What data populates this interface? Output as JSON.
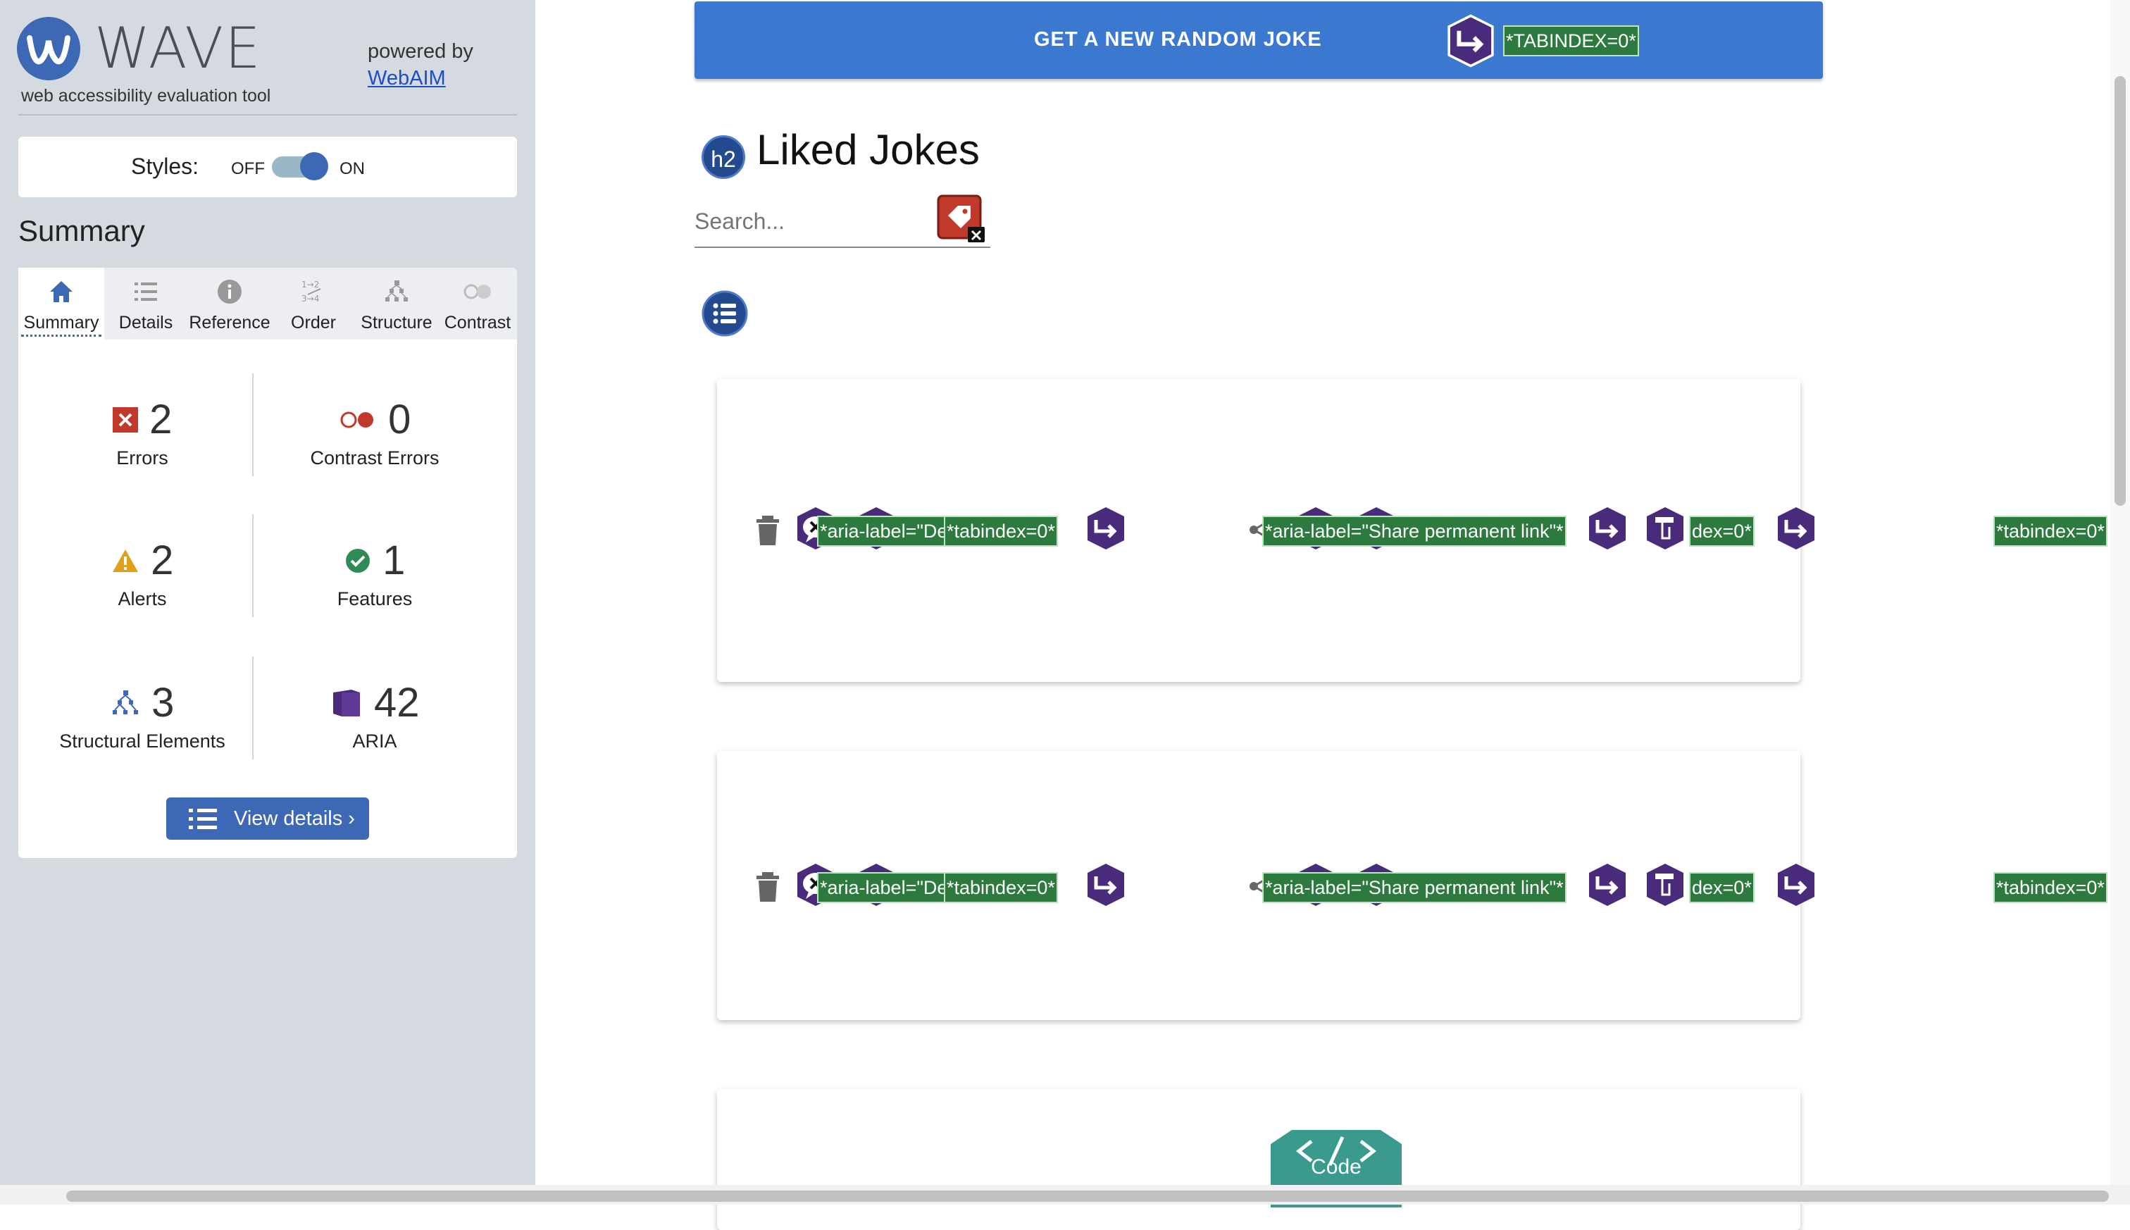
{
  "wave": {
    "logo_text": "WAVE",
    "subtitle": "web accessibility evaluation tool",
    "powered_by": "powered by",
    "webaim_link": "WebAIM",
    "styles": {
      "label": "Styles:",
      "off": "OFF",
      "on": "ON",
      "state": "on"
    },
    "summary_heading": "Summary",
    "tabs": [
      {
        "label": "Summary",
        "icon": "home-icon",
        "selected": true
      },
      {
        "label": "Details",
        "icon": "details-list-icon"
      },
      {
        "label": "Reference",
        "icon": "info-icon"
      },
      {
        "label": "Order",
        "icon": "order-icon"
      },
      {
        "label": "Structure",
        "icon": "structure-icon"
      },
      {
        "label": "Contrast",
        "icon": "contrast-icon"
      }
    ],
    "stats": {
      "errors": {
        "count": "2",
        "label": "Errors"
      },
      "contrast_errors": {
        "count": "0",
        "label": "Contrast Errors"
      },
      "alerts": {
        "count": "2",
        "label": "Alerts"
      },
      "features": {
        "count": "1",
        "label": "Features"
      },
      "structural": {
        "count": "3",
        "label": "Structural Elements"
      },
      "aria": {
        "count": "42",
        "label": "ARIA"
      }
    },
    "view_details": "View details ›"
  },
  "page": {
    "random_joke_button": "GET A NEW RANDOM JOKE",
    "random_joke_tag": "*TABINDEX=0*",
    "h2_badge": "h2",
    "heading": "Liked Jokes",
    "search_placeholder": "Search...",
    "card_tags": {
      "delete_label": "*aria-label=\"Delete\"*",
      "tabindex": "*tabindex=0*",
      "share_label": "*aria-label=\"Share permanent link\"*",
      "tabindex_cut": "dex=0*",
      "tabindex_last": "*tabindex=0*"
    },
    "code_badge": "Code"
  },
  "colors": {
    "wave_blue": "#3d68b5",
    "aria_purple": "#4a2a7a",
    "tag_green": "#2d7a3f",
    "error_red": "#c0392b",
    "button_blue": "#3b78d0"
  }
}
